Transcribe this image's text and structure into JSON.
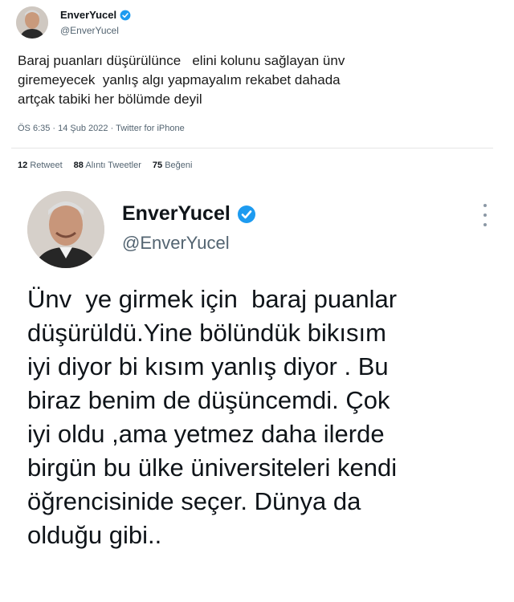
{
  "tweet_small": {
    "display_name": "EnverYucel",
    "handle": "@EnverYucel",
    "text": "Baraj puanları düşürülünce   elini kolunu sağlayan ünv\ngiremeyecek  yanlış algı yapmayalım rekabet dahada\nartçak tabiki her bölümde deyil",
    "meta": "ÖS 6:35 · 14 Şub 2022 · Twitter for iPhone",
    "stats": {
      "retweets_count": "12",
      "retweets_label": "Retweet",
      "quotes_count": "88",
      "quotes_label": "Alıntı Tweetler",
      "likes_count": "75",
      "likes_label": "Beğeni"
    }
  },
  "tweet_large": {
    "display_name": "EnverYucel",
    "handle": "@EnverYucel",
    "text": "Ünv  ye girmek için  baraj puanlar\ndüşürüldü.Yine bölündük bikısım\niyi diyor bi kısım yanlış diyor . Bu\nbiraz benim de düşüncemdi. Çok\niyi oldu ,ama yetmez daha ilerde\nbirgün bu ülke üniversiteleri kendi\nöğrencisinide seçer. Dünya da\nolduğu gibi.."
  },
  "colors": {
    "verified_blue": "#1d9bf0",
    "secondary_text": "#536471"
  },
  "icons": [
    "avatar",
    "verified-badge-icon",
    "more-options-icon"
  ]
}
